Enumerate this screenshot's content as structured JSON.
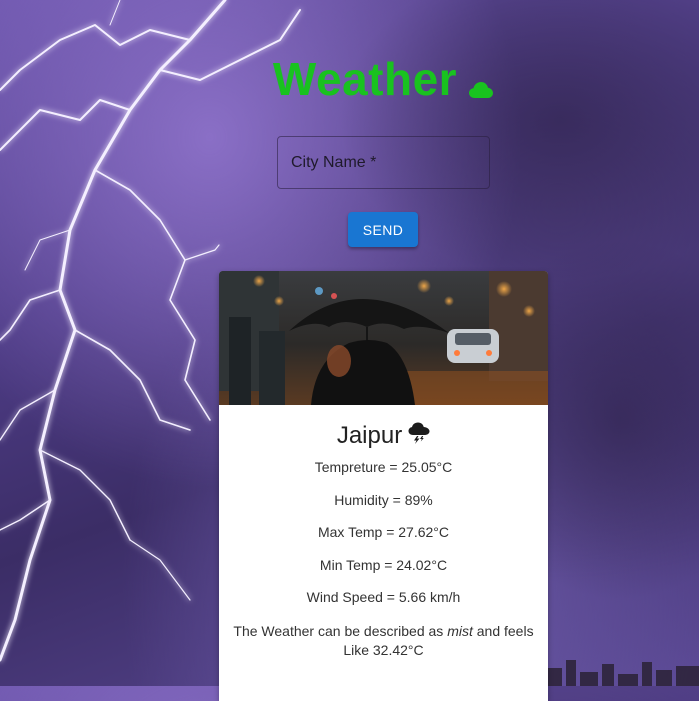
{
  "header": {
    "title": "Weather",
    "title_icon": "cloud-icon",
    "title_color": "#19c21f"
  },
  "search": {
    "label": "City Name *"
  },
  "send_button": {
    "label": "SEND",
    "color": "#1976d2"
  },
  "card": {
    "city": "Jaipur",
    "weather_icon": "storm-cloud-icon",
    "temperature": "Tempreture = 25.05°C",
    "humidity": "Humidity = 89%",
    "max_temp": "Max Temp = 27.62°C",
    "min_temp": "Min Temp = 24.02°C",
    "wind_speed": "Wind Speed = 5.66 km/h",
    "desc_prefix": "The Weather can be described as ",
    "desc_condition": "mist",
    "desc_suffix": " and feels Like 32.42°C"
  },
  "background_image": "purple lightning storm",
  "card_image": "person with umbrella on rainy city street"
}
